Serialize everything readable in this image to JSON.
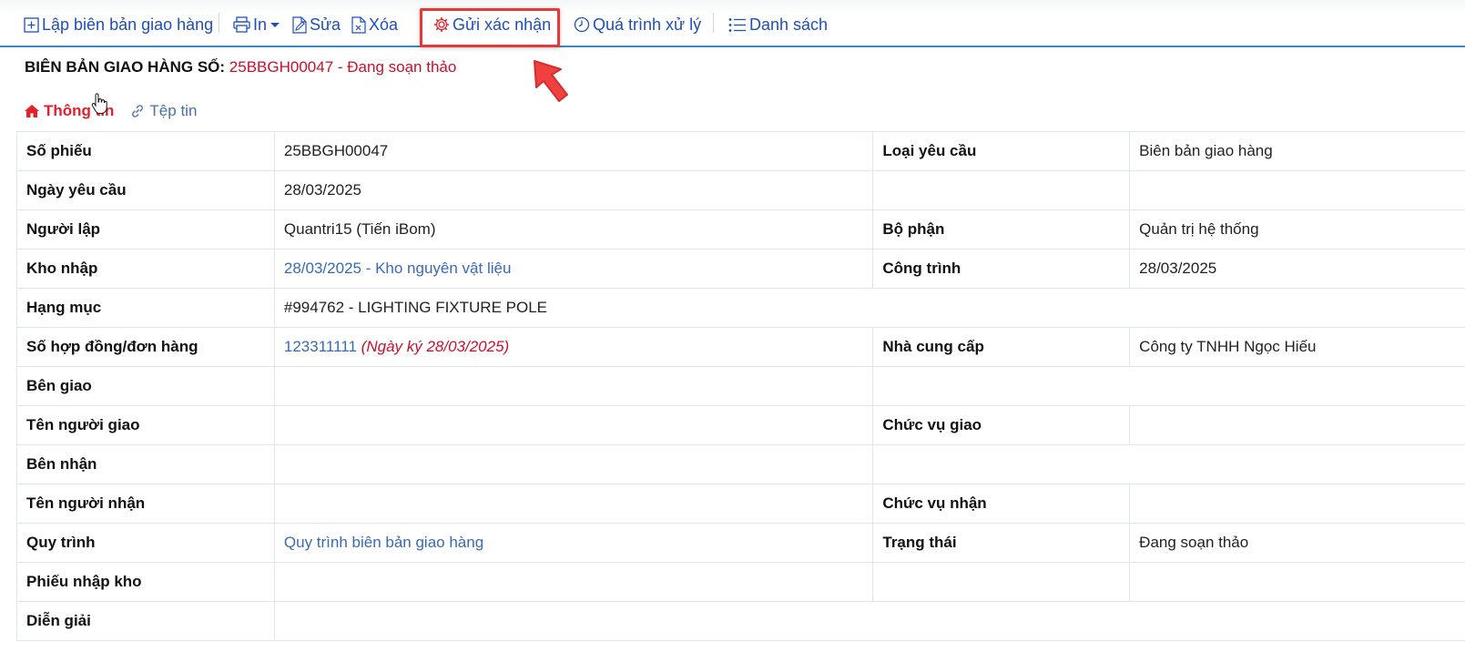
{
  "toolbar": {
    "create_label": "Lập biên bản giao hàng",
    "print_label": "In",
    "edit_label": "Sửa",
    "delete_label": "Xóa",
    "send_confirm_label": "Gửi xác nhận",
    "process_label": "Quá trình xử lý",
    "list_label": "Danh sách"
  },
  "header": {
    "title_label": "BIÊN BẢN GIAO HÀNG SỐ:",
    "title_value": "25BBGH00047 - Đang soạn thảo"
  },
  "tabs": [
    {
      "label": "Thông tin",
      "active": true
    },
    {
      "label": "Tệp tin",
      "active": false
    }
  ],
  "details": {
    "so_phieu": {
      "label": "Số phiếu",
      "value": "25BBGH00047"
    },
    "loai_yeu_cau": {
      "label": "Loại yêu cầu",
      "value": "Biên bản giao hàng"
    },
    "ngay_yeu_cau": {
      "label": "Ngày yêu cầu",
      "value": "28/03/2025"
    },
    "nguoi_lap": {
      "label": "Người lập",
      "value": "Quantri15 (Tiến iBom)"
    },
    "bo_phan": {
      "label": "Bộ phận",
      "value": "Quản trị hệ thống"
    },
    "kho_nhap": {
      "label": "Kho nhập",
      "value": "28/03/2025 - Kho nguyên vật liệu"
    },
    "cong_trinh": {
      "label": "Công trình",
      "value": "28/03/2025"
    },
    "hang_muc": {
      "label": "Hạng mục",
      "value": "#994762 - LIGHTING FIXTURE POLE"
    },
    "so_hop_dong": {
      "label": "Số hợp đồng/đơn hàng",
      "value": "123311111",
      "note": "(Ngày ký 28/03/2025)"
    },
    "nha_cung_cap": {
      "label": "Nhà cung cấp",
      "value": "Công ty TNHH Ngọc Hiếu"
    },
    "ben_giao": {
      "label": "Bên giao",
      "value": ""
    },
    "ten_nguoi_giao": {
      "label": "Tên người giao",
      "value": ""
    },
    "chuc_vu_giao": {
      "label": "Chức vụ giao",
      "value": ""
    },
    "ben_nhan": {
      "label": "Bên nhận",
      "value": ""
    },
    "ten_nguoi_nhan": {
      "label": "Tên người nhận",
      "value": ""
    },
    "chuc_vu_nhan": {
      "label": "Chức vụ nhận",
      "value": ""
    },
    "quy_trinh": {
      "label": "Quy trình",
      "value": "Quy trình biên bản giao hàng"
    },
    "trang_thai": {
      "label": "Trạng thái",
      "value": "Đang soạn thảo"
    },
    "phieu_nhap_kho": {
      "label": "Phiếu nhập kho",
      "value": ""
    },
    "dien_giai": {
      "label": "Diễn giải",
      "value": ""
    }
  },
  "colors": {
    "link_blue": "#1f4fb8",
    "accent_red": "#e0202a",
    "status_red": "#c8102e",
    "divider_blue": "#3a87c8"
  },
  "icons": [
    "plus-square-icon",
    "printer-icon",
    "caret-down-icon",
    "edit-doc-icon",
    "delete-doc-icon",
    "gear-icon",
    "clock-icon",
    "list-icon",
    "home-icon",
    "link-icon",
    "hand-cursor-icon",
    "red-arrow-icon"
  ]
}
